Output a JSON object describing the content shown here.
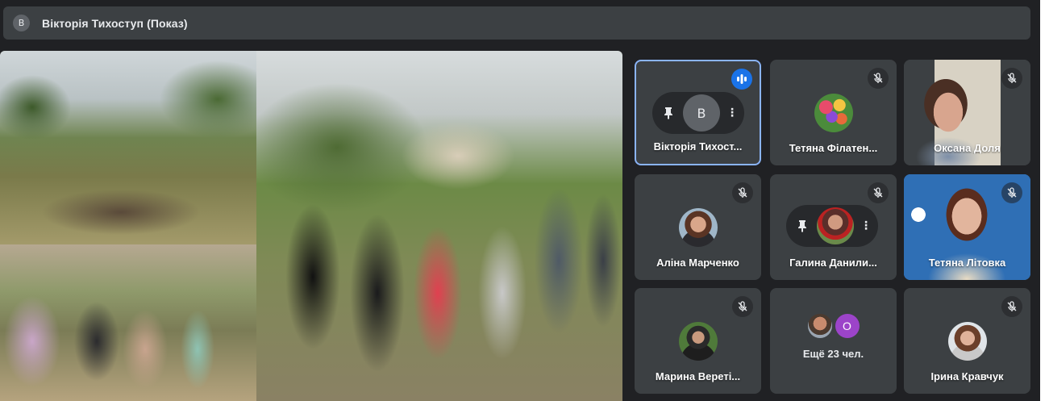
{
  "header": {
    "avatar_letter": "В",
    "title": "Вікторія Тихоступ (Показ)"
  },
  "presentation": {
    "description_photos": 3
  },
  "tiles": [
    {
      "name": "Вікторія Тихост...",
      "state": "speaking",
      "hover_letter": "В",
      "pinned_controls": true
    },
    {
      "name": "Тетяна Філатен...",
      "state": "muted"
    },
    {
      "name": "Оксана Доля",
      "state": "muted"
    },
    {
      "name": "Аліна Марченко",
      "state": "muted"
    },
    {
      "name": "Галина Данили...",
      "state": "muted"
    },
    {
      "name": "Тетяна Літовка",
      "state": "muted"
    },
    {
      "name": "Марина Вереті...",
      "state": "muted"
    },
    {
      "name": "Ещё 23 чел.",
      "extra_letter": "О"
    },
    {
      "name": "Ірина Кравчук",
      "state": "muted"
    }
  ],
  "colors": {
    "background": "#202124",
    "tile": "#3c4043",
    "active_border": "#8ab4f8",
    "speaking": "#1a73e8",
    "extra_avatar": "#9c44c9"
  },
  "icons": {
    "mute": "mic-off-icon",
    "speaking": "audio-levels-icon",
    "pin": "pin-icon",
    "more": "more-vert-icon"
  }
}
